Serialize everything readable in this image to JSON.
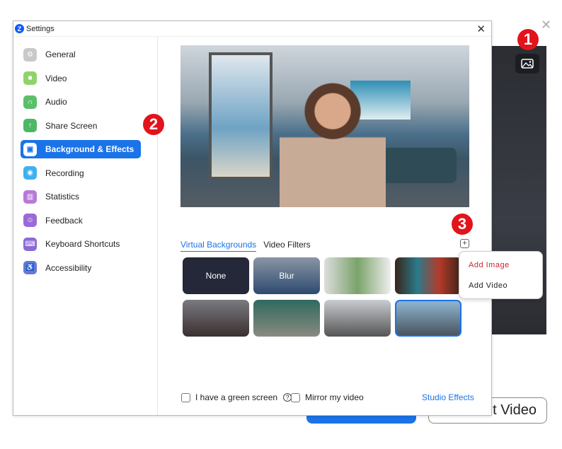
{
  "window": {
    "title": "Settings",
    "logo_letter": "Z"
  },
  "sidebar": {
    "items": [
      {
        "label": "General",
        "icon": "gear-icon",
        "color": "#c9c9c9",
        "glyph": "⚙"
      },
      {
        "label": "Video",
        "icon": "video-camera-icon",
        "color": "#8fd46a",
        "glyph": "■"
      },
      {
        "label": "Audio",
        "icon": "headphones-icon",
        "color": "#5cbf6a",
        "glyph": "∩"
      },
      {
        "label": "Share Screen",
        "icon": "share-screen-icon",
        "color": "#4cb866",
        "glyph": "↑"
      },
      {
        "label": "Background & Effects",
        "icon": "background-person-icon",
        "color": "#1a73e8",
        "glyph": "▣",
        "active": true
      },
      {
        "label": "Recording",
        "icon": "record-icon",
        "color": "#3fb0f0",
        "glyph": "◉"
      },
      {
        "label": "Statistics",
        "icon": "bar-chart-icon",
        "color": "#b77ad8",
        "glyph": "▥"
      },
      {
        "label": "Feedback",
        "icon": "smiley-icon",
        "color": "#9b6ad8",
        "glyph": "☺"
      },
      {
        "label": "Keyboard Shortcuts",
        "icon": "keyboard-icon",
        "color": "#8a6ad6",
        "glyph": "⌨"
      },
      {
        "label": "Accessibility",
        "icon": "accessibility-icon",
        "color": "#6a78d0",
        "glyph": "♿"
      }
    ]
  },
  "tabs": [
    "Virtual Backgrounds",
    "Video Filters"
  ],
  "thumbnails": [
    {
      "label": "None"
    },
    {
      "label": "Blur"
    },
    {
      "label": ""
    },
    {
      "label": ""
    },
    {
      "label": ""
    },
    {
      "label": ""
    },
    {
      "label": ""
    },
    {
      "label": "",
      "selected": true
    }
  ],
  "add_menu": {
    "items": [
      "Add Image",
      "Add Video"
    ],
    "highlight_color": "#c8262e"
  },
  "options": {
    "green_screen": "I have a green screen",
    "mirror": "Mirror my video",
    "studio_effects": "Studio Effects"
  },
  "badges": [
    "1",
    "2",
    "3"
  ],
  "background_button": "ut Video",
  "accent": "#1a73e8"
}
